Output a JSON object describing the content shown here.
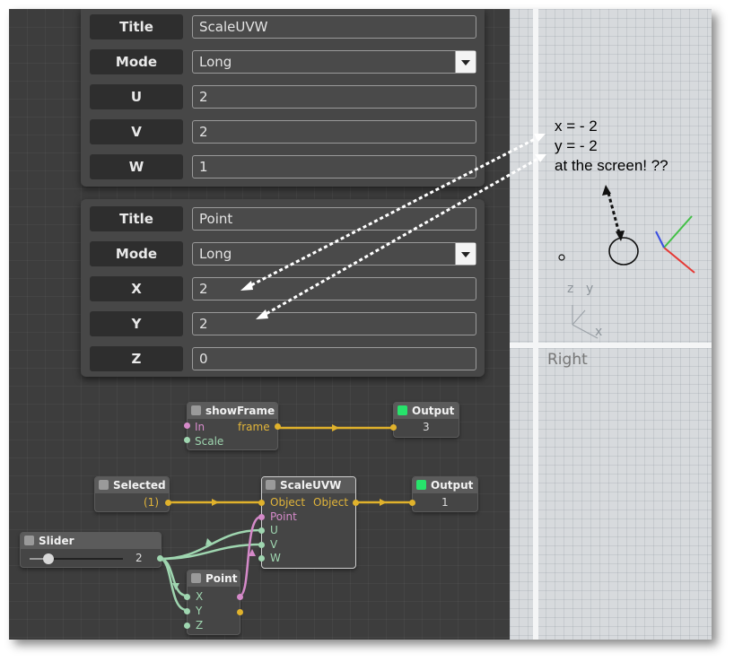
{
  "panel1": {
    "rows": [
      {
        "label": "Title",
        "value": "ScaleUVW"
      },
      {
        "label": "Mode",
        "value": "Long"
      },
      {
        "label": "U",
        "value": "2"
      },
      {
        "label": "V",
        "value": "2"
      },
      {
        "label": "W",
        "value": "1"
      }
    ]
  },
  "panel2": {
    "rows": [
      {
        "label": "Title",
        "value": "Point"
      },
      {
        "label": "Mode",
        "value": "Long"
      },
      {
        "label": "X",
        "value": "2"
      },
      {
        "label": "Y",
        "value": "2"
      },
      {
        "label": "Z",
        "value": "0"
      }
    ]
  },
  "nodes": {
    "showframe": {
      "title": "showFrame",
      "in": "In",
      "scale": "Scale",
      "frame": "frame"
    },
    "output1": {
      "title": "Output",
      "value": "3"
    },
    "selected": {
      "title": "Selected",
      "value": "(1)"
    },
    "scaleuvw": {
      "title": "ScaleUVW",
      "object_in": "Object",
      "object_out": "Object",
      "point": "Point",
      "u": "U",
      "v": "V",
      "w": "W"
    },
    "output2": {
      "title": "Output",
      "value": "1"
    },
    "slider": {
      "title": "Slider",
      "value": "2",
      "level": 0.2
    },
    "point": {
      "title": "Point",
      "x": "X",
      "y": "Y",
      "z": "Z"
    }
  },
  "viewport": {
    "label": "Right",
    "axis_z": "z",
    "axis_y": "y",
    "axis_x": "x"
  },
  "annotation": {
    "line1": "x = - 2",
    "line2": "y = - 2",
    "line3": "at the screen! ??"
  },
  "colors": {
    "wire_yellow": "#e0b22c",
    "wire_green": "#9fd6b0",
    "wire_pink": "#d58ac9",
    "status_green": "#27e36b",
    "axis_red": "#e53935",
    "axis_green": "#43c047",
    "axis_blue": "#3b4fe0"
  }
}
